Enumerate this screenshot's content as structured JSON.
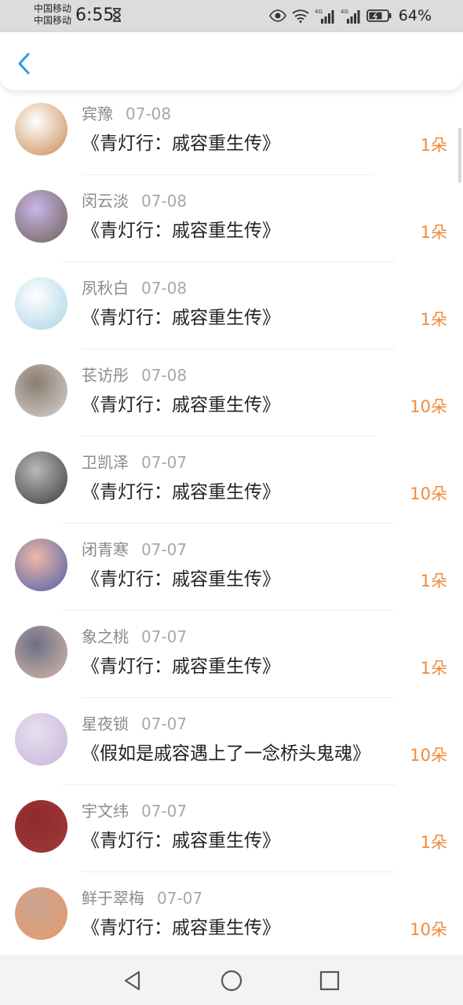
{
  "status_bar": {
    "carrier_1": "中国移动",
    "carrier_2": "中国移动",
    "time": "6:55",
    "battery": "64%"
  },
  "header": {
    "back_icon": "chevron-left-icon"
  },
  "colors": {
    "accent": "#2a9fe8",
    "count": "#f08a3a"
  },
  "list": [
    {
      "name": "宾豫",
      "date": "07-08",
      "book": "《青灯行：戚容重生传》",
      "count": "1朵",
      "avatar_colors": [
        "#ffffff",
        "#c98a53"
      ]
    },
    {
      "name": "闵云淡",
      "date": "07-08",
      "book": "《青灯行：戚容重生传》",
      "count": "1朵",
      "avatar_colors": [
        "#c9b6e8",
        "#6d5f54"
      ]
    },
    {
      "name": "夙秋白",
      "date": "07-08",
      "book": "《青灯行：戚容重生传》",
      "count": "1朵",
      "avatar_colors": [
        "#ffffff",
        "#a9d3e6"
      ]
    },
    {
      "name": "苌访彤",
      "date": "07-08",
      "book": "《青灯行：戚容重生传》",
      "count": "10朵",
      "avatar_colors": [
        "#8a7d72",
        "#d8d2cc"
      ]
    },
    {
      "name": "卫凯泽",
      "date": "07-07",
      "book": "《青灯行：戚容重生传》",
      "count": "10朵",
      "avatar_colors": [
        "#b9b9b9",
        "#3c3c3c"
      ]
    },
    {
      "name": "闭青寒",
      "date": "07-07",
      "book": "《青灯行：戚容重生传》",
      "count": "1朵",
      "avatar_colors": [
        "#f0b8a8",
        "#4c5fa8"
      ]
    },
    {
      "name": "象之桃",
      "date": "07-07",
      "book": "《青灯行：戚容重生传》",
      "count": "1朵",
      "avatar_colors": [
        "#6b6f86",
        "#d9b9a8"
      ]
    },
    {
      "name": "星夜锁",
      "date": "07-07",
      "book": "《假如是戚容遇上了一念桥头鬼魂》",
      "count": "10朵",
      "avatar_colors": [
        "#e6e1f0",
        "#c9b3d9"
      ]
    },
    {
      "name": "宇文纬",
      "date": "07-07",
      "book": "《青灯行：戚容重生传》",
      "count": "1朵",
      "avatar_colors": [
        "#8e2a2a",
        "#a23a3a"
      ]
    },
    {
      "name": "鲜于翠梅",
      "date": "07-07",
      "book": "《青灯行：戚容重生传》",
      "count": "10朵",
      "avatar_colors": [
        "#c9a592",
        "#e89a6a"
      ]
    }
  ],
  "navbar": {
    "back_icon": "triangle-back-icon",
    "home_icon": "circle-home-icon",
    "recents_icon": "square-recents-icon"
  }
}
